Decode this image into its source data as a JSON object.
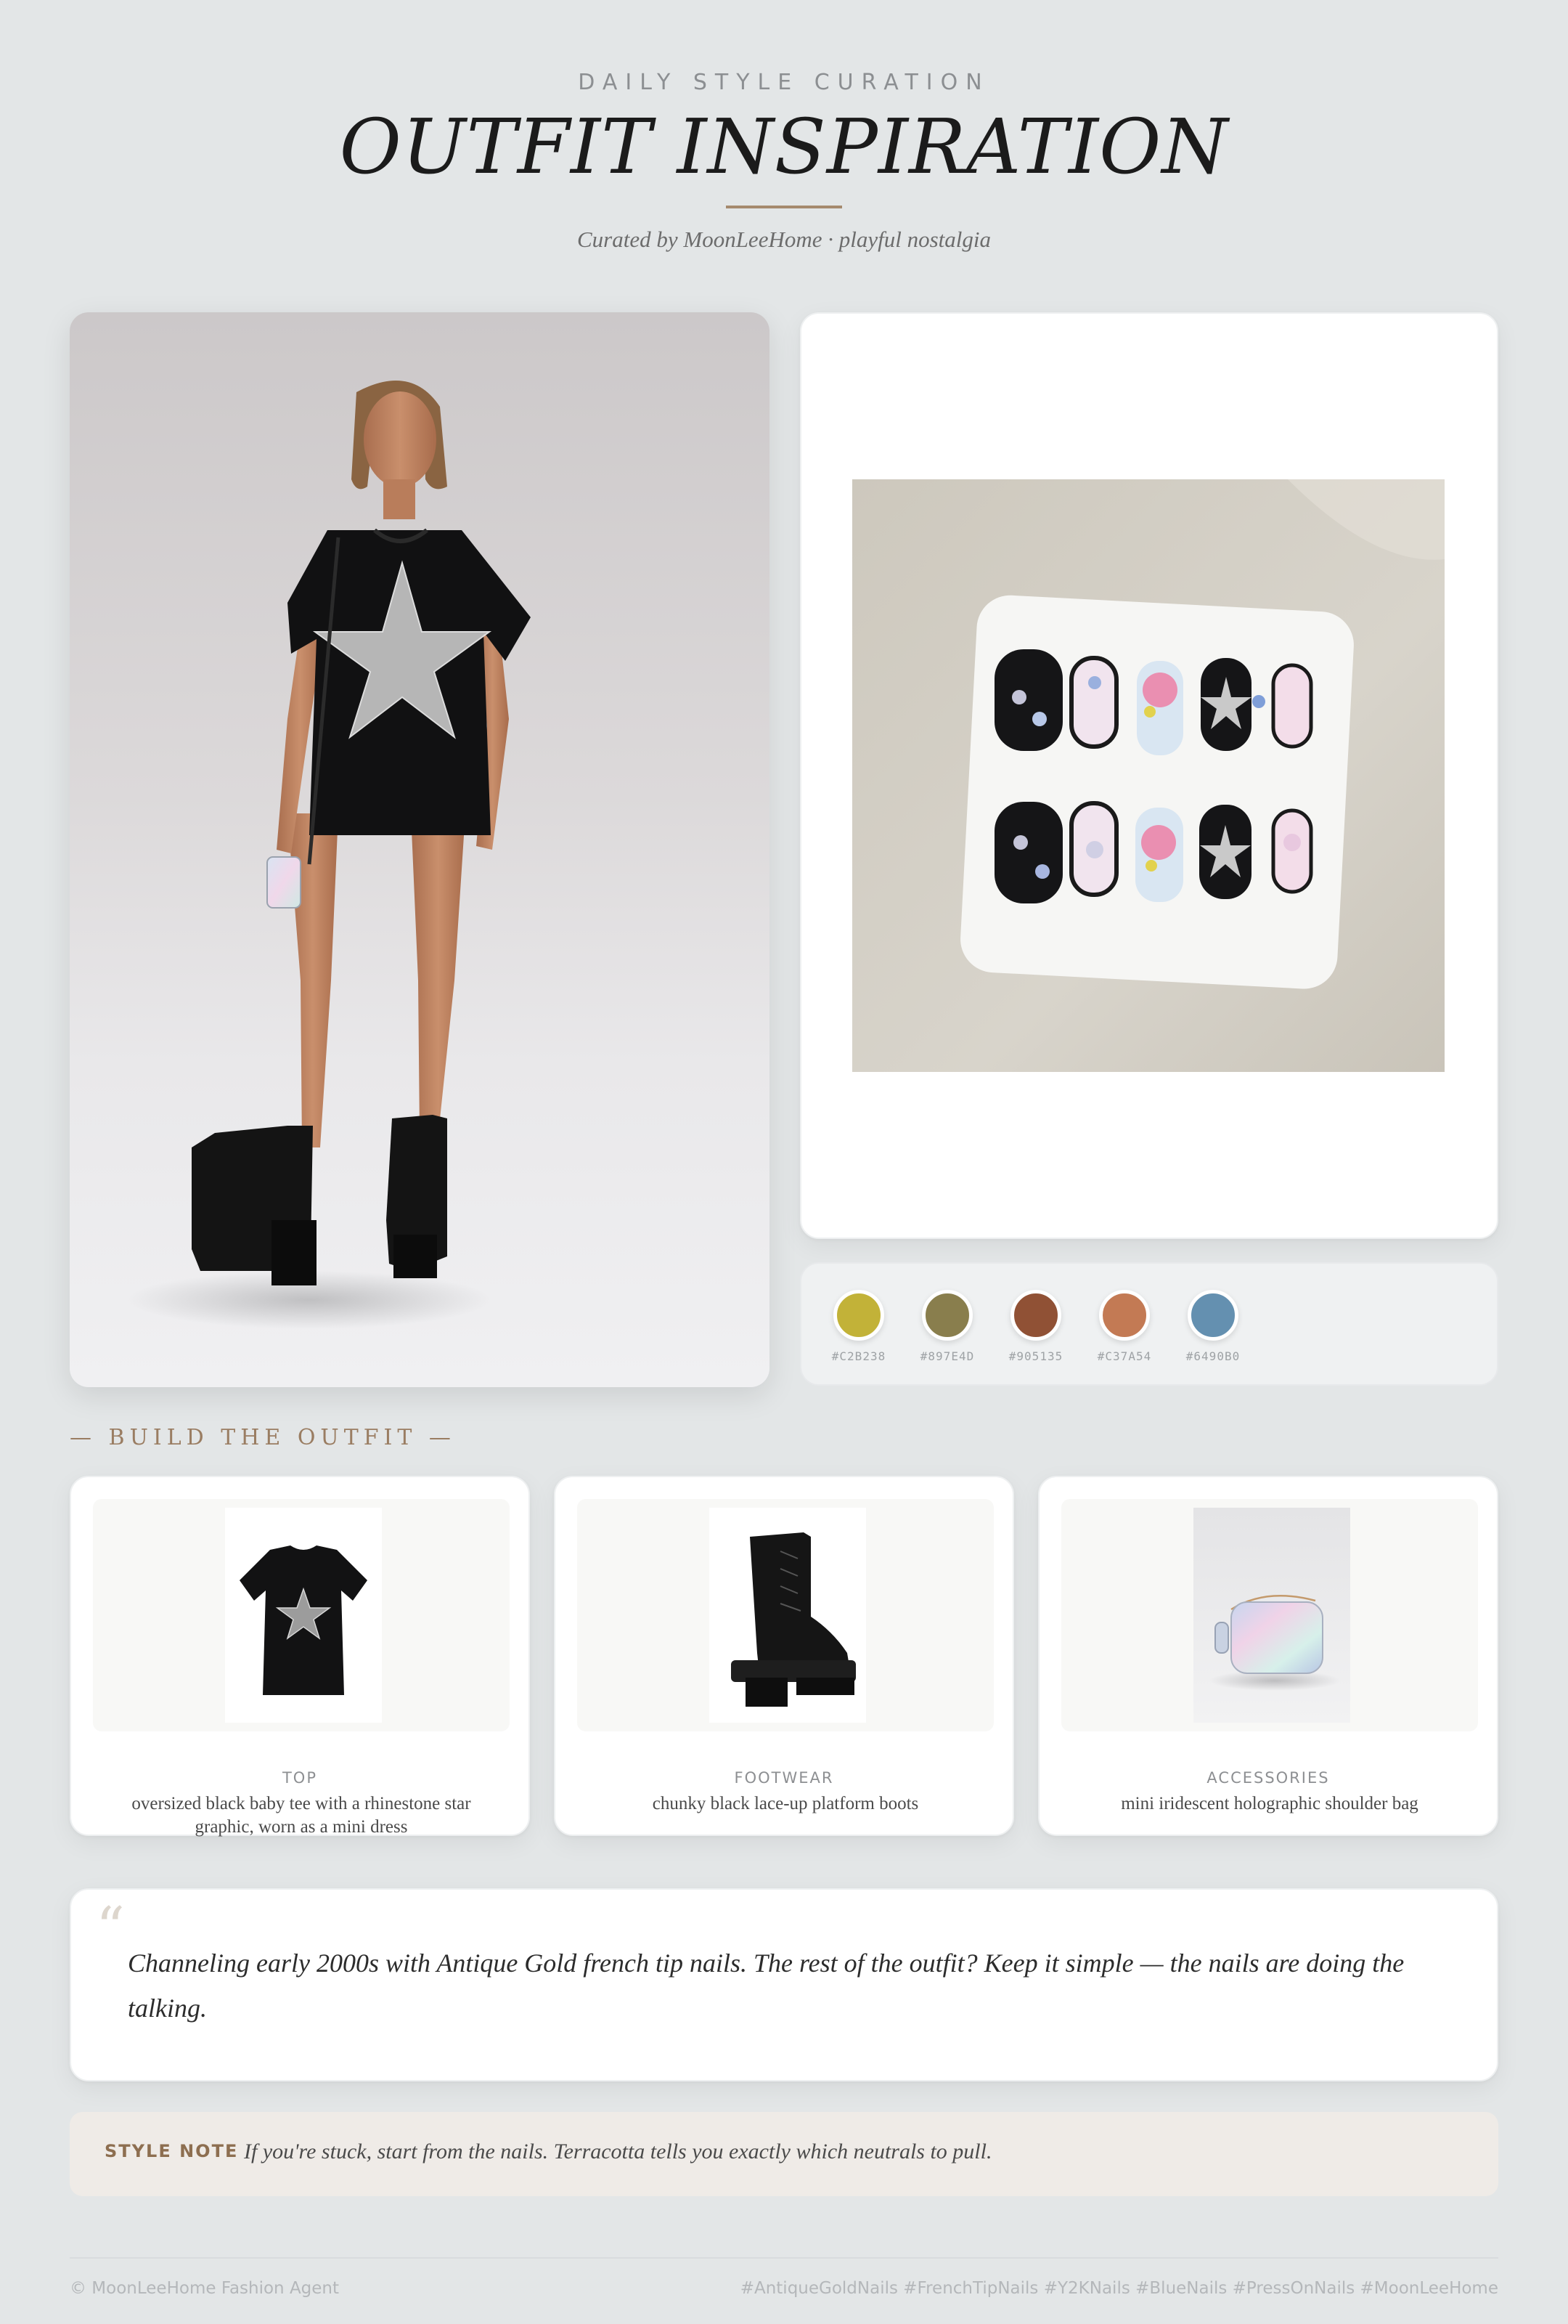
{
  "header": {
    "eyebrow": "DAILY STYLE CURATION",
    "title": "OUTFIT INSPIRATION",
    "subtitle": "Curated by MoonLeeHome · playful nostalgia"
  },
  "palette": {
    "swatches": [
      {
        "hex": "#C2B238",
        "label": "#C2B238"
      },
      {
        "hex": "#897E4D",
        "label": "#897E4D"
      },
      {
        "hex": "#905135",
        "label": "#905135"
      },
      {
        "hex": "#C37A54",
        "label": "#C37A54"
      },
      {
        "hex": "#6490B0",
        "label": "#6490B0"
      }
    ]
  },
  "build": {
    "section_title": "— BUILD THE OUTFIT —",
    "items": [
      {
        "category": "TOP",
        "description": "oversized black baby tee with a rhinestone star graphic, worn as a mini dress"
      },
      {
        "category": "FOOTWEAR",
        "description": "chunky black lace-up platform boots"
      },
      {
        "category": "ACCESSORIES",
        "description": "mini iridescent holographic shoulder bag"
      }
    ]
  },
  "quote": {
    "mark": "“",
    "text": "Channeling early 2000s with Antique Gold french tip nails. The rest of the outfit? Keep it simple — the nails are doing the talking."
  },
  "note": {
    "label": "STYLE NOTE",
    "text": "If you're stuck, start from the nails. Terracotta tells you exactly which neutrals to pull."
  },
  "footer": {
    "left": "© MoonLeeHome Fashion Agent",
    "right": "#AntiqueGoldNails #FrenchTipNails #Y2KNails #BlueNails #PressOnNails #MoonLeeHome"
  },
  "images": {
    "hero": "model-outfit-photo",
    "nails": "press-on-nails-photo",
    "top": "star-tee-product-photo",
    "footwear": "platform-boot-product-photo",
    "accessory": "holographic-bag-product-photo"
  }
}
